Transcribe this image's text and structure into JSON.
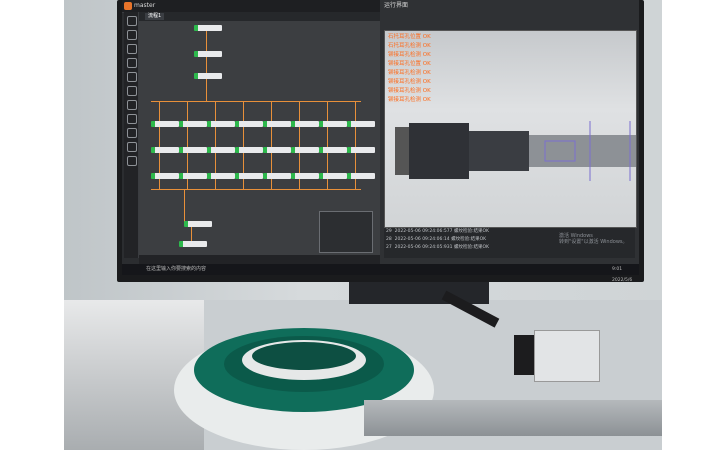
{
  "app": {
    "title": "master",
    "tab_label": "流程1",
    "panel_title": "运行界面",
    "taskbar_search": "在这里输入你要搜索的内容",
    "taskbar_clock": "9:01\n2022/5/6"
  },
  "overlay": {
    "lines": [
      "石托耳孔位置 OK",
      "石托耳孔检测 OK",
      "铆接耳孔检测 OK",
      "铆接耳孔位置 OK",
      "铆接耳孔检测 OK",
      "铆接耳孔检测 OK",
      "铆接耳孔检测 OK",
      "铆接耳孔检测 OK"
    ]
  },
  "log": {
    "rows": [
      {
        "id": "29",
        "time": "2022-05-06 09:24:06:577",
        "msg": "螺纹检验:结果OK"
      },
      {
        "id": "28",
        "time": "2022-05-06 09:24:06:14",
        "msg": "螺纹检验:结果OK"
      },
      {
        "id": "27",
        "time": "2022-05-06 09:24:05:931",
        "msg": "螺纹检验:结果OK"
      }
    ]
  },
  "watermark": {
    "line1": "激活 Windows",
    "line2": "转到\"设置\"以激活 Windows。"
  },
  "colors": {
    "accent": "#e8903a",
    "node_ok": "#2db84c",
    "overlay_text": "#ff6a1a"
  }
}
